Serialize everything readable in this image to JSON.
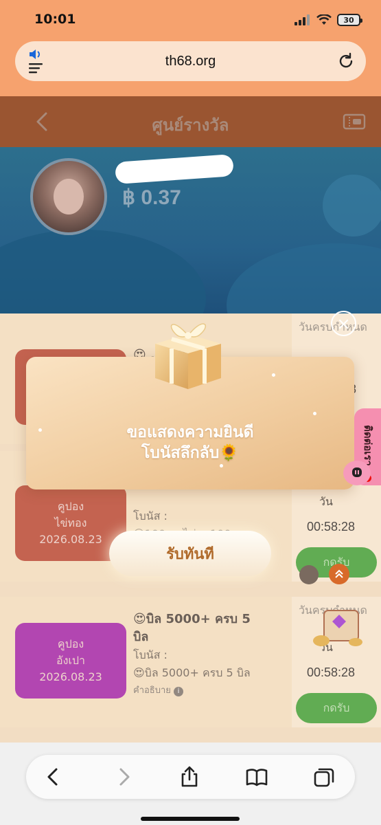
{
  "status": {
    "time": "10:01",
    "battery": "30"
  },
  "browser": {
    "url": "th68.org"
  },
  "header": {
    "title": "ศูนย์รางวัล"
  },
  "profile": {
    "balance": "฿ 0.37"
  },
  "cards": [
    {
      "coupon_line1": "",
      "coupon_line2": "",
      "coupon_date": "",
      "title": "😍 ... 58",
      "deadline_label": "วันครบกำหนด",
      "days": "วัน",
      "timer": "8"
    },
    {
      "coupon_line1": "คูปอง",
      "coupon_line2": "ไข่ทอง",
      "coupon_date": "2026.08.23",
      "bonus_label": "โบนัส :",
      "bonus_value": "😍100 ... ไข่... 100",
      "days": "วัน",
      "timer": "00:58:28",
      "claim": "กดรับ"
    },
    {
      "coupon_line1": "คูปอง",
      "coupon_line2": "อังเปา",
      "coupon_date": "2026.08.23",
      "title_a": "😍บิล ",
      "title_b": "5000+",
      "title_c": " ครบ 5",
      "title_d": "บิล",
      "bonus_label": "โบนัส :",
      "bonus_value": "😍บิล 5000+ ครบ 5 บิล",
      "description": "คำอธิบาย",
      "deadline_label": "วันครบกำหนด",
      "days": "วัน",
      "timer": "00:58:28",
      "claim": "กดรับ"
    }
  ],
  "modal": {
    "line1": "ขอแสดงความยินดี",
    "line2": "โบนัสลึกลับ🌻",
    "claim_now": "รับทันที",
    "close": "×"
  },
  "contact": {
    "label": "ติดต่อเรา"
  },
  "colors": {
    "header_bg": "#9a5531",
    "banner_bg": "#27618a",
    "claim_green": "#3f9a2e",
    "coupon_red": "#b8412a",
    "coupon_purple": "#a21ea0"
  }
}
